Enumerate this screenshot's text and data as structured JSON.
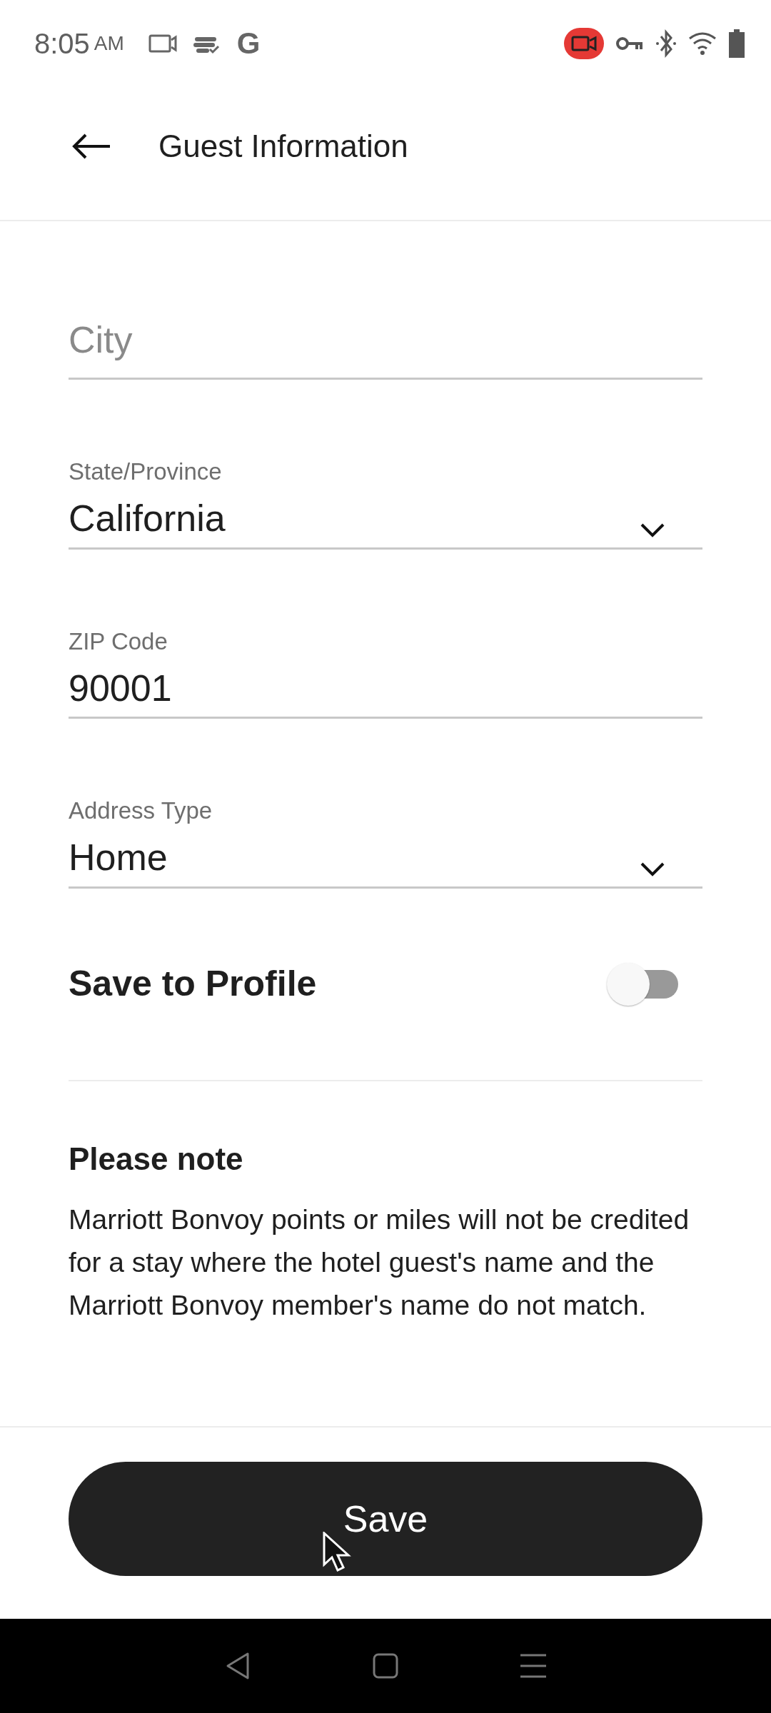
{
  "status_bar": {
    "time": "8:05",
    "period": "AM",
    "app_letter": "G",
    "recording": true
  },
  "header": {
    "title": "Guest Information"
  },
  "fields": [
    {
      "kind": "text",
      "placeholder": "City"
    },
    {
      "kind": "select",
      "label": "State/Province",
      "value": "California"
    },
    {
      "kind": "text",
      "label": "ZIP Code",
      "value": "90001"
    },
    {
      "kind": "select",
      "label": "Address Type",
      "value": "Home"
    }
  ],
  "save_to_profile": {
    "label": "Save to Profile",
    "on": false
  },
  "note": {
    "title": "Please note",
    "body": "Marriott Bonvoy points or miles will not be credited for a stay where the hotel guest's name and the Marriott Bonvoy member's name do not match."
  },
  "save_button": {
    "label": "Save"
  }
}
